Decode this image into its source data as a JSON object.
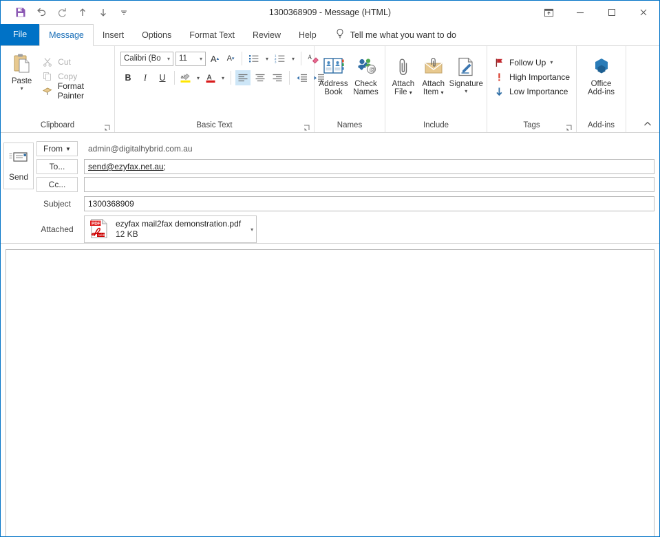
{
  "window": {
    "title": "1300368909  -  Message (HTML)",
    "quick_access": [
      {
        "name": "save-icon",
        "label": "Save"
      },
      {
        "name": "undo-icon",
        "label": "Undo"
      },
      {
        "name": "redo-icon",
        "label": "Redo"
      },
      {
        "name": "previous-item-icon",
        "label": "Previous Item"
      },
      {
        "name": "next-item-icon",
        "label": "Next Item"
      },
      {
        "name": "customize-quick-access-toolbar-icon",
        "label": "Customize Quick Access Toolbar"
      }
    ],
    "controls": [
      {
        "name": "ribbon-display-options",
        "label": "Ribbon Display Options"
      },
      {
        "name": "minimize",
        "label": "Minimize"
      },
      {
        "name": "maximize",
        "label": "Maximize"
      },
      {
        "name": "close",
        "label": "Close"
      }
    ],
    "accent_color": "#0072c6",
    "save_icon_color": "#8c59b4"
  },
  "tabs": [
    {
      "label": "File",
      "active": false,
      "kind": "file"
    },
    {
      "label": "Message",
      "active": true,
      "kind": "normal"
    },
    {
      "label": "Insert",
      "active": false,
      "kind": "normal"
    },
    {
      "label": "Options",
      "active": false,
      "kind": "normal"
    },
    {
      "label": "Format Text",
      "active": false,
      "kind": "normal"
    },
    {
      "label": "Review",
      "active": false,
      "kind": "normal"
    },
    {
      "label": "Help",
      "active": false,
      "kind": "normal"
    }
  ],
  "tell_me": {
    "placeholder": "Tell me what you want to do",
    "icon": "lightbulb-icon"
  },
  "ribbon": {
    "collapse_label": "Collapse the Ribbon",
    "groups": {
      "clipboard": {
        "label": "Clipboard",
        "paste": "Paste",
        "cut": "Cut",
        "copy": "Copy",
        "format_painter": "Format Painter"
      },
      "basic_text": {
        "label": "Basic Text",
        "font_name": "Calibri (Bo",
        "font_size": "11",
        "grow_font": "A",
        "shrink_font": "A",
        "bold": "B",
        "italic": "I",
        "underline": "U",
        "highlight": "Text Highlight Color",
        "font_color": "A",
        "bullets": "Bullets",
        "numbering": "Numbering",
        "clear_formatting": "Clear All Formatting",
        "align_left": "Align Left",
        "align_center": "Center",
        "align_right": "Align Right",
        "decrease_indent": "Decrease Indent",
        "increase_indent": "Increase Indent"
      },
      "names": {
        "label": "Names",
        "address_book": "Address\nBook",
        "address_book_l1": "Address",
        "address_book_l2": "Book",
        "check_names_l1": "Check",
        "check_names_l2": "Names"
      },
      "include": {
        "label": "Include",
        "attach_file_l1": "Attach",
        "attach_file_l2": "File",
        "attach_item_l1": "Attach",
        "attach_item_l2": "Item",
        "signature": "Signature"
      },
      "tags": {
        "label": "Tags",
        "follow_up": "Follow Up",
        "high_importance": "High Importance",
        "low_importance": "Low Importance"
      },
      "addins": {
        "label": "Add-ins",
        "office_addins_l1": "Office",
        "office_addins_l2": "Add-ins"
      }
    }
  },
  "compose": {
    "send_button": "Send",
    "from": {
      "button_label": "From",
      "value": "admin@digitalhybrid.com.au"
    },
    "to": {
      "button_label": "To...",
      "value": "send@ezyfax.net.au",
      "separator": ";"
    },
    "cc": {
      "button_label": "Cc...",
      "value": ""
    },
    "subject": {
      "label": "Subject",
      "value": "1300368909"
    },
    "attached": {
      "label": "Attached",
      "file_name": "ezyfax mail2fax demonstration.pdf",
      "file_size": "12 KB",
      "file_type": "pdf",
      "icon_badge": "PDF",
      "icon_brand": "Adobe"
    },
    "body": {
      "value": ""
    }
  }
}
